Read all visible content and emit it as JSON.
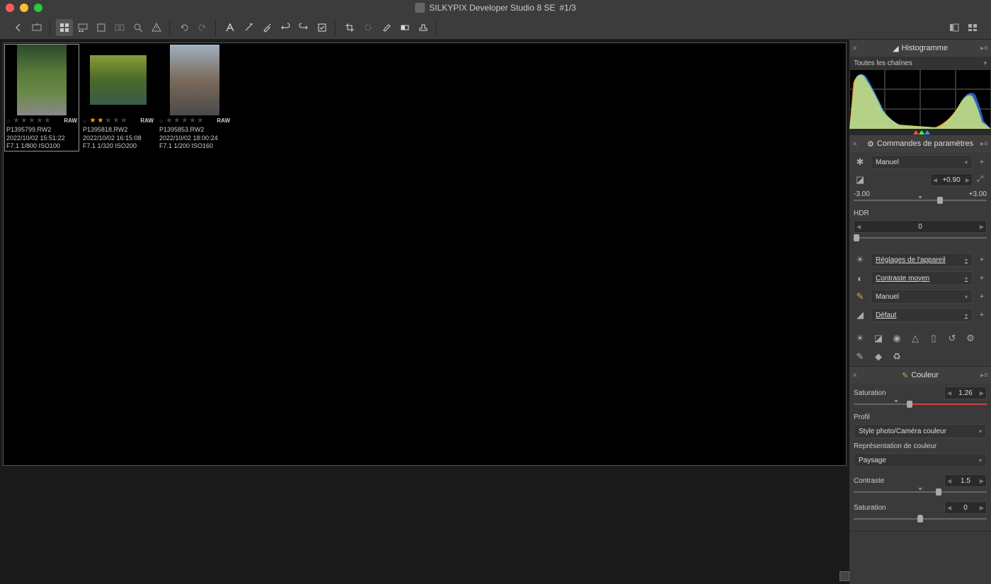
{
  "app": {
    "title": "SILKYPIX Developer Studio 8 SE",
    "counter": "#1/3"
  },
  "thumbnails": [
    {
      "file": "P1395799.RW2",
      "date": "2022/10/02 15:51:22",
      "exif": "F7.1 1/800 ISO100",
      "stars": 0,
      "raw": "RAW",
      "selected": true
    },
    {
      "file": "P1395818.RW2",
      "date": "2022/10/02 16:15:08",
      "exif": "F7.1 1/320 ISO200",
      "stars": 2,
      "raw": "RAW",
      "selected": false
    },
    {
      "file": "P1395853.RW2",
      "date": "2022/10/02 18:00:24",
      "exif": "F7.1 1/200 ISO160",
      "stars": 0,
      "raw": "RAW",
      "selected": false
    }
  ],
  "panels": {
    "histogram": {
      "title": "Histogramme",
      "channels": "Toutes les chaînes"
    },
    "params": {
      "title": "Commandes de paramètres",
      "mode": "Manuel",
      "exposure": {
        "value": "+0.90",
        "min": "-3.00",
        "max": "+3.00",
        "knob_pct": 65
      },
      "hdr": {
        "label": "HDR",
        "value": "0",
        "knob_pct": 2
      },
      "white_balance": "Réglages de l'appareil",
      "contrast_preset": "Contraste moyen",
      "color_mode": "Manuel",
      "sharpness": "Défaut"
    },
    "color": {
      "title": "Couleur",
      "saturation": {
        "label": "Saturation",
        "value": "1.26",
        "knob_pct": 42
      },
      "profile_label": "Profil",
      "profile": "Style photo/Caméra couleur",
      "repr_label": "Représentation de couleur",
      "repr": "Paysage",
      "contrast": {
        "label": "Contraste",
        "value": "1.5",
        "knob_pct": 64
      },
      "saturation2": {
        "label": "Saturation",
        "value": "0",
        "knob_pct": 50
      }
    }
  }
}
